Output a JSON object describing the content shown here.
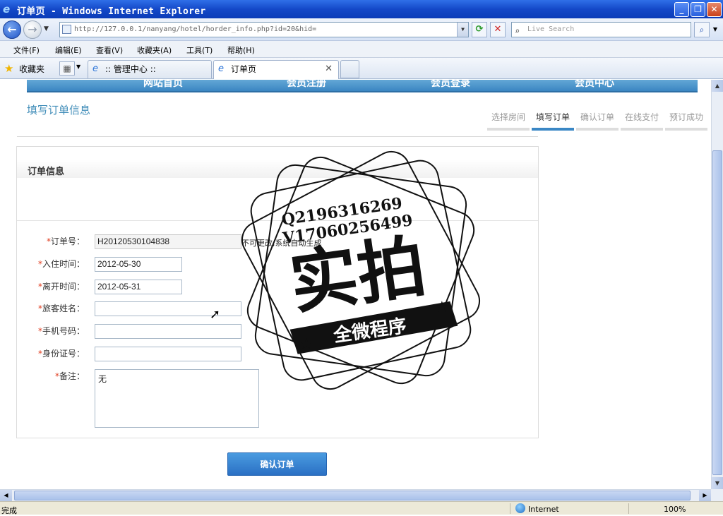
{
  "window": {
    "title": "订单页 - Windows Internet Explorer",
    "minimize": "_",
    "maximize": "❐",
    "close": "✕"
  },
  "nav": {
    "address": "http://127.0.0.1/nanyang/hotel/horder_info.php?id=20&hid=",
    "search_placeholder": "Live Search"
  },
  "menu": [
    "文件(F)",
    "编辑(E)",
    "查看(V)",
    "收藏夹(A)",
    "工具(T)",
    "帮助(H)"
  ],
  "favorites": {
    "label": "收藏夹",
    "tabs": [
      {
        "label": ":: 管理中心 ::",
        "active": false
      },
      {
        "label": "订单页",
        "active": true
      }
    ]
  },
  "site": {
    "topnav": [
      "网站首页",
      "会员注册",
      "会员登录",
      "会员中心"
    ],
    "page_title": "填写订单信息",
    "steps": [
      {
        "label": "选择房间",
        "active": false
      },
      {
        "label": "填写订单",
        "active": true
      },
      {
        "label": "确认订单",
        "active": false
      },
      {
        "label": "在线支付",
        "active": false
      },
      {
        "label": "预订成功",
        "active": false
      }
    ],
    "section_title": "订单信息",
    "form": {
      "order_no": {
        "label": "订单号：",
        "value": "H20120530104838",
        "hint": "不可更改,系统自动生成"
      },
      "checkin": {
        "label": "入住时间：",
        "value": "2012-05-30"
      },
      "checkout": {
        "label": "离开时间：",
        "value": "2012-05-31"
      },
      "guest_name": {
        "label": "旅客姓名：",
        "value": ""
      },
      "phone": {
        "label": "手机号码：",
        "value": ""
      },
      "id_no": {
        "label": "身份证号：",
        "value": ""
      },
      "remark": {
        "label": "备注：",
        "value": "无"
      }
    },
    "required_mark": "*",
    "submit_label": "确认订单"
  },
  "watermark": {
    "line1": "Q2196316269",
    "line2": "V17060256499",
    "big": "实拍",
    "banner": "全微程序"
  },
  "status": {
    "text": "完成",
    "zone": "Internet",
    "zoom": "100%"
  }
}
